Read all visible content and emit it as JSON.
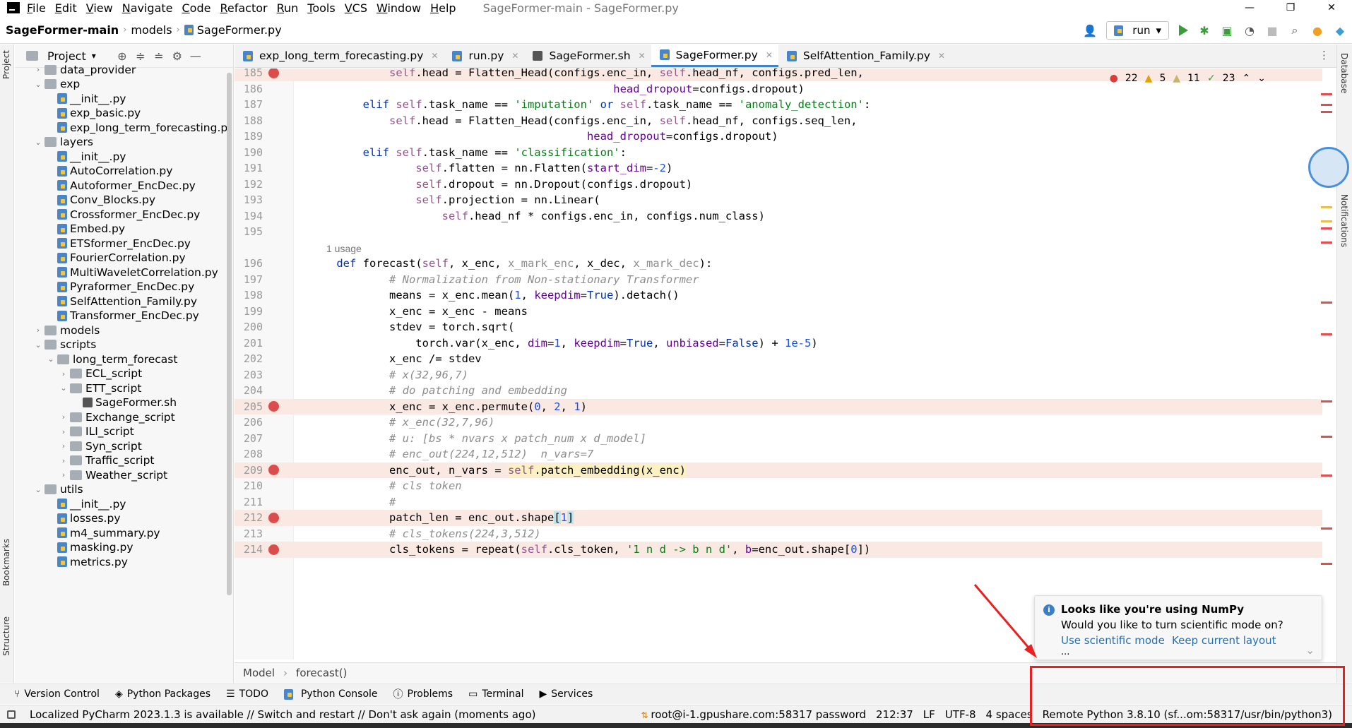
{
  "menubar": {
    "items": [
      "File",
      "Edit",
      "View",
      "Navigate",
      "Code",
      "Refactor",
      "Run",
      "Tools",
      "VCS",
      "Window",
      "Help"
    ],
    "window_title": "SageFormer-main - SageFormer.py"
  },
  "navbar": {
    "crumbs": [
      "SageFormer-main",
      "models",
      "SageFormer.py"
    ],
    "run_config": "run"
  },
  "side": {
    "project": "Project",
    "bookmarks": "Bookmarks",
    "structure": "Structure",
    "database": "Database",
    "notifications": "Notifications"
  },
  "project_panel": {
    "title": "Project",
    "tree": [
      {
        "label": "data_provider",
        "type": "folder",
        "depth": 1,
        "expanded": false
      },
      {
        "label": "exp",
        "type": "folder",
        "depth": 1,
        "expanded": true
      },
      {
        "label": "__init__.py",
        "type": "py",
        "depth": 2
      },
      {
        "label": "exp_basic.py",
        "type": "py",
        "depth": 2
      },
      {
        "label": "exp_long_term_forecasting.p",
        "type": "py",
        "depth": 2
      },
      {
        "label": "layers",
        "type": "folder",
        "depth": 1,
        "expanded": true
      },
      {
        "label": "__init__.py",
        "type": "py",
        "depth": 2
      },
      {
        "label": "AutoCorrelation.py",
        "type": "py",
        "depth": 2
      },
      {
        "label": "Autoformer_EncDec.py",
        "type": "py",
        "depth": 2
      },
      {
        "label": "Conv_Blocks.py",
        "type": "py",
        "depth": 2
      },
      {
        "label": "Crossformer_EncDec.py",
        "type": "py",
        "depth": 2
      },
      {
        "label": "Embed.py",
        "type": "py",
        "depth": 2
      },
      {
        "label": "ETSformer_EncDec.py",
        "type": "py",
        "depth": 2
      },
      {
        "label": "FourierCorrelation.py",
        "type": "py",
        "depth": 2
      },
      {
        "label": "MultiWaveletCorrelation.py",
        "type": "py",
        "depth": 2
      },
      {
        "label": "Pyraformer_EncDec.py",
        "type": "py",
        "depth": 2
      },
      {
        "label": "SelfAttention_Family.py",
        "type": "py",
        "depth": 2
      },
      {
        "label": "Transformer_EncDec.py",
        "type": "py",
        "depth": 2
      },
      {
        "label": "models",
        "type": "folder",
        "depth": 1,
        "expanded": false
      },
      {
        "label": "scripts",
        "type": "folder",
        "depth": 1,
        "expanded": true
      },
      {
        "label": "long_term_forecast",
        "type": "folder",
        "depth": 2,
        "expanded": true
      },
      {
        "label": "ECL_script",
        "type": "folder",
        "depth": 3,
        "expanded": false
      },
      {
        "label": "ETT_script",
        "type": "folder",
        "depth": 3,
        "expanded": true
      },
      {
        "label": "SageFormer.sh",
        "type": "sh",
        "depth": 4
      },
      {
        "label": "Exchange_script",
        "type": "folder",
        "depth": 3,
        "expanded": false
      },
      {
        "label": "ILI_script",
        "type": "folder",
        "depth": 3,
        "expanded": false
      },
      {
        "label": "Syn_script",
        "type": "folder",
        "depth": 3,
        "expanded": false
      },
      {
        "label": "Traffic_script",
        "type": "folder",
        "depth": 3,
        "expanded": false
      },
      {
        "label": "Weather_script",
        "type": "folder",
        "depth": 3,
        "expanded": false
      },
      {
        "label": "utils",
        "type": "folder",
        "depth": 1,
        "expanded": true
      },
      {
        "label": "__init__.py",
        "type": "py",
        "depth": 2
      },
      {
        "label": "losses.py",
        "type": "py",
        "depth": 2
      },
      {
        "label": "m4_summary.py",
        "type": "py",
        "depth": 2
      },
      {
        "label": "masking.py",
        "type": "py",
        "depth": 2
      },
      {
        "label": "metrics.py",
        "type": "py",
        "depth": 2
      }
    ]
  },
  "tabs": [
    {
      "label": "exp_long_term_forecasting.py",
      "icon": "python-file-icon",
      "active": false
    },
    {
      "label": "run.py",
      "icon": "python-file-icon",
      "active": false
    },
    {
      "label": "SageFormer.sh",
      "icon": "shell-file-icon",
      "active": false
    },
    {
      "label": "SageFormer.py",
      "icon": "python-file-icon",
      "active": true
    },
    {
      "label": "SelfAttention_Family.py",
      "icon": "python-file-icon",
      "active": false
    }
  ],
  "inspections": {
    "errors": "22",
    "warnings": "5",
    "weak_warnings": "11",
    "typos": "23"
  },
  "editor": {
    "usage_hint": "1 usage",
    "lines": [
      {
        "n": "185",
        "bp": true
      },
      {
        "n": "186",
        "bp": false
      },
      {
        "n": "187",
        "bp": false
      },
      {
        "n": "188",
        "bp": false
      },
      {
        "n": "189",
        "bp": false
      },
      {
        "n": "190",
        "bp": false
      },
      {
        "n": "191",
        "bp": false
      },
      {
        "n": "192",
        "bp": false
      },
      {
        "n": "193",
        "bp": false
      },
      {
        "n": "194",
        "bp": false
      },
      {
        "n": "195",
        "bp": false
      },
      {
        "n": "196",
        "bp": false
      },
      {
        "n": "197",
        "bp": false
      },
      {
        "n": "198",
        "bp": false
      },
      {
        "n": "199",
        "bp": false
      },
      {
        "n": "200",
        "bp": false
      },
      {
        "n": "201",
        "bp": false
      },
      {
        "n": "202",
        "bp": false
      },
      {
        "n": "203",
        "bp": false
      },
      {
        "n": "204",
        "bp": false
      },
      {
        "n": "205",
        "bp": true
      },
      {
        "n": "206",
        "bp": false
      },
      {
        "n": "207",
        "bp": false
      },
      {
        "n": "208",
        "bp": false
      },
      {
        "n": "209",
        "bp": true
      },
      {
        "n": "210",
        "bp": false
      },
      {
        "n": "211",
        "bp": false
      },
      {
        "n": "212",
        "bp": true
      },
      {
        "n": "213",
        "bp": false
      },
      {
        "n": "214",
        "bp": true
      }
    ]
  },
  "code_breadcrumb": [
    "Model",
    "forecast()"
  ],
  "notification": {
    "title": "Looks like you're using NumPy",
    "message": "Would you like to turn scientific mode on?",
    "action_primary": "Use scientific mode",
    "action_secondary": "Keep current layout",
    "more": "..."
  },
  "toolwindows": [
    "Version Control",
    "Python Packages",
    "TODO",
    "Python Console",
    "Problems",
    "Terminal",
    "Services"
  ],
  "status": {
    "message": "Localized PyCharm 2023.1.3 is available // Switch and restart // Don't ask again (moments ago)",
    "connection": "root@i-1.gpushare.com:58317 password",
    "position": "212:37",
    "line_sep": "LF",
    "encoding": "UTF-8",
    "indent": "4 spaces",
    "interpreter": "Remote Python 3.8.10 (sf...om:58317/usr/bin/python3)"
  },
  "colors": {
    "accent": "#4083c9",
    "breakpoint": "#db4c4c",
    "annotation": "#e8201f"
  }
}
